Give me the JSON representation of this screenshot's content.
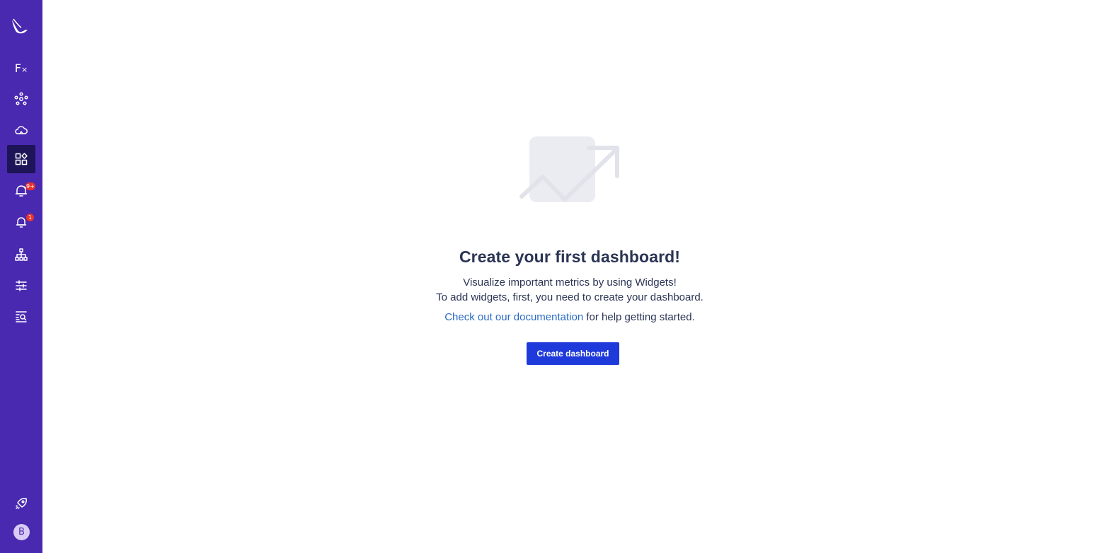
{
  "sidebar": {
    "logo": "bird-logo",
    "items": [
      {
        "name": "functions",
        "icon": "fx-icon",
        "active": false
      },
      {
        "name": "network",
        "icon": "network-nodes-icon",
        "active": false
      },
      {
        "name": "cloud",
        "icon": "cloud-icon",
        "active": false
      },
      {
        "name": "dashboards",
        "icon": "dashboard-grid-icon",
        "active": true
      },
      {
        "name": "alerts",
        "icon": "bell-alert-icon",
        "active": false,
        "badge": "9+"
      },
      {
        "name": "notifications",
        "icon": "bell-icon",
        "active": false,
        "badge": "1"
      },
      {
        "name": "hierarchy",
        "icon": "hierarchy-icon",
        "active": false
      },
      {
        "name": "settings",
        "icon": "sliders-icon",
        "active": false
      },
      {
        "name": "search-logs",
        "icon": "list-search-icon",
        "active": false
      }
    ],
    "bottom": {
      "launch_icon": "rocket-icon",
      "avatar_initial": "B"
    },
    "colors": {
      "background": "#4929b0",
      "active": "#1e1458",
      "badge": "#e8322f"
    }
  },
  "empty_state": {
    "illustration": "chart-trend-illustration",
    "title": "Create your first dashboard!",
    "description_line1": "Visualize important metrics by using Widgets!",
    "description_line2": "To add widgets, first, you need to create your dashboard.",
    "doc_link": "Check out our documentation",
    "doc_suffix": " for help getting started.",
    "button_label": "Create dashboard",
    "colors": {
      "text": "#2a3454",
      "link": "#2a6cc4",
      "button": "#1f3adb"
    }
  }
}
